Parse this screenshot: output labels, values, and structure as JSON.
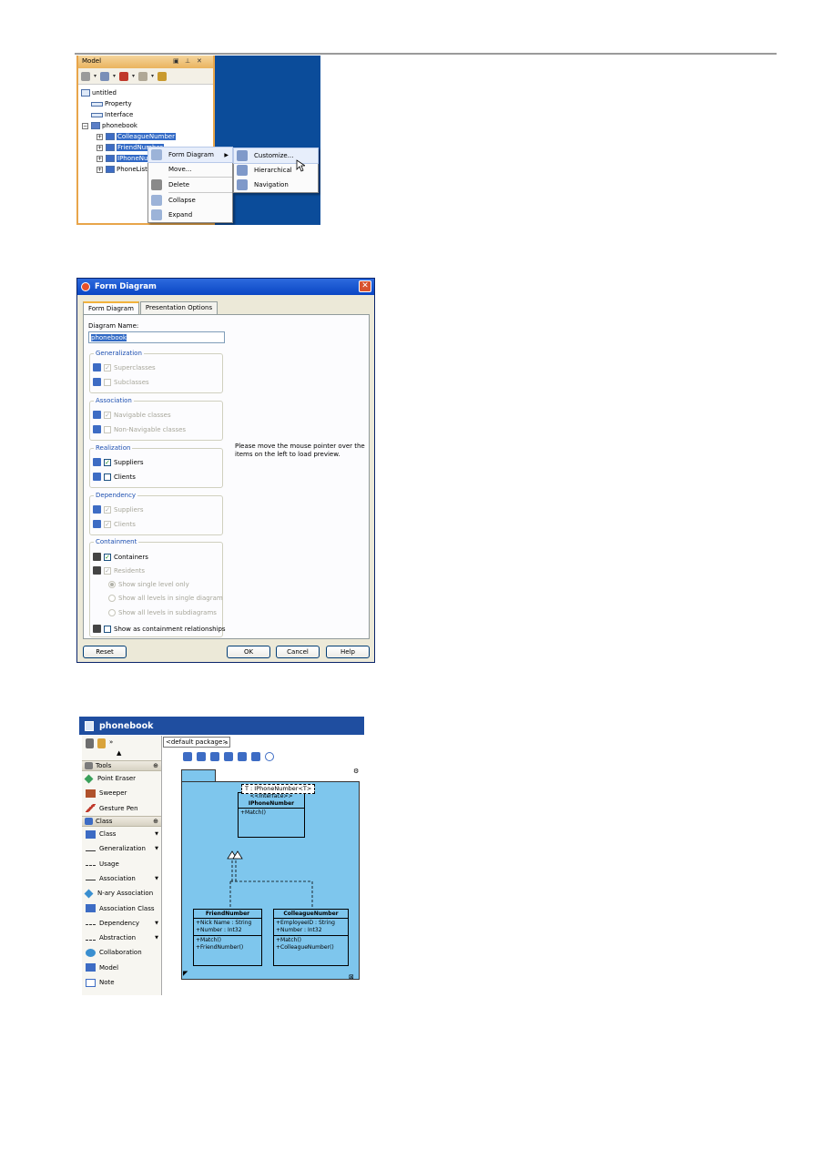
{
  "model_panel": {
    "title": "Model",
    "tree": {
      "root": "untitled",
      "items": [
        "Property",
        "Interface",
        "phonebook"
      ],
      "children": [
        "ColleagueNumber",
        "FriendNumber",
        "IPhoneNumber",
        "PhoneList"
      ]
    },
    "context_menu": {
      "items": [
        "Form Diagram",
        "Move...",
        "Delete",
        "Collapse",
        "Expand"
      ]
    },
    "submenu": {
      "items": [
        "Customize...",
        "Hierarchical",
        "Navigation"
      ]
    }
  },
  "form_dialog": {
    "title": "Form Diagram",
    "close_glyph": "✕",
    "tabs": [
      "Form Diagram",
      "Presentation Options"
    ],
    "name_label": "Diagram Name:",
    "name_value": "phonebook",
    "groups": {
      "generalization": {
        "title": "Generalization",
        "items": [
          {
            "label": "Superclasses",
            "checked": true,
            "enabled": false
          },
          {
            "label": "Subclasses",
            "checked": false,
            "enabled": false
          }
        ]
      },
      "association": {
        "title": "Association",
        "items": [
          {
            "label": "Navigable classes",
            "checked": true,
            "enabled": false
          },
          {
            "label": "Non-Navigable classes",
            "checked": false,
            "enabled": false
          }
        ]
      },
      "realization": {
        "title": "Realization",
        "items": [
          {
            "label": "Suppliers",
            "checked": true,
            "enabled": true
          },
          {
            "label": "Clients",
            "checked": false,
            "enabled": true
          }
        ]
      },
      "dependency": {
        "title": "Dependency",
        "items": [
          {
            "label": "Suppliers",
            "checked": true,
            "enabled": false
          },
          {
            "label": "Clients",
            "checked": true,
            "enabled": false
          }
        ]
      },
      "containment": {
        "title": "Containment",
        "containers": "Containers",
        "residents": "Residents",
        "radios": [
          "Show single level only",
          "Show all levels in single diagram",
          "Show all levels in subdiagrams"
        ],
        "show_as": "Show as containment relationships"
      }
    },
    "preview_text": "Please move the mouse pointer over the items on the left to load preview.",
    "buttons": {
      "reset": "Reset",
      "ok": "OK",
      "cancel": "Cancel",
      "help": "Help"
    }
  },
  "editor": {
    "title": "phonebook",
    "package_tab": "<default package>",
    "palette": {
      "tools_header": "Tools",
      "tools": [
        "Point Eraser",
        "Sweeper",
        "Gesture Pen"
      ],
      "class_header": "Class",
      "class_items": [
        "Class",
        "Generalization",
        "Usage",
        "Association",
        "N-ary Association",
        "Association Class",
        "Dependency",
        "Abstraction",
        "Collaboration",
        "Model",
        "Note"
      ]
    },
    "diagram": {
      "template_param": "T : IPhoneNumber<T>",
      "interface": {
        "stereotype": "<<Interface>>",
        "name": "IPhoneNumber",
        "ops": [
          "+Match()"
        ]
      },
      "friend": {
        "name": "FriendNumber",
        "attrs": [
          "+Nick Name : String",
          "+Number : Int32"
        ],
        "ops": [
          "+Match()",
          "+FriendNumber()"
        ]
      },
      "colleague": {
        "name": "ColleagueNumber",
        "attrs": [
          "+EmployeeID : String",
          "+Number : Int32"
        ],
        "ops": [
          "+Match()",
          "+ColleagueNumber()"
        ]
      }
    }
  }
}
